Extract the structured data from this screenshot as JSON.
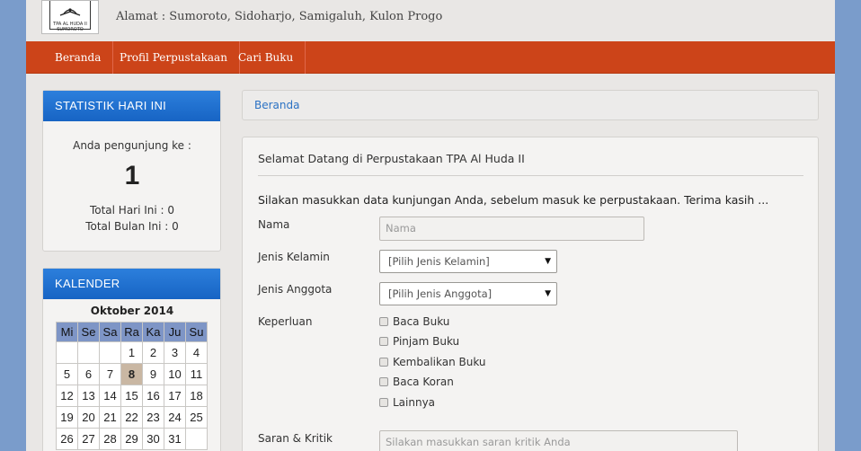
{
  "header": {
    "logo_text": "TPA AL HUDA II SUMOROTO",
    "address": "Alamat : Sumoroto, Sidoharjo, Samigaluh, Kulon Progo"
  },
  "nav": {
    "items": [
      "Beranda",
      "Profil Perpustakaan",
      "Cari Buku"
    ]
  },
  "colors": {
    "navbar": "#cc4419",
    "panel_header": "#1e6fd0",
    "background": "#7a9ccb",
    "link": "#2b72c4"
  },
  "stats": {
    "title": "STATISTIK HARI INI",
    "visitor_label": "Anda pengunjung ke :",
    "visitor_number": "1",
    "today_total": "Total Hari Ini : 0",
    "month_total": "Total Bulan Ini : 0"
  },
  "calendar": {
    "title": "KALENDER",
    "month": "Oktober 2014",
    "days": [
      "Mi",
      "Se",
      "Sa",
      "Ra",
      "Ka",
      "Ju",
      "Su"
    ],
    "weeks": [
      [
        "",
        "",
        "",
        "1",
        "2",
        "3",
        "4"
      ],
      [
        "5",
        "6",
        "7",
        "8",
        "9",
        "10",
        "11"
      ],
      [
        "12",
        "13",
        "14",
        "15",
        "16",
        "17",
        "18"
      ],
      [
        "19",
        "20",
        "21",
        "22",
        "23",
        "24",
        "25"
      ],
      [
        "26",
        "27",
        "28",
        "29",
        "30",
        "31",
        ""
      ]
    ],
    "today": "8"
  },
  "breadcrumb": {
    "current": "Beranda"
  },
  "form": {
    "title": "Selamat Datang di Perpustakaan TPA Al Huda II",
    "intro": "Silakan masukkan data kunjungan Anda, sebelum masuk ke perpustakaan. Terima kasih ...",
    "name_label": "Nama",
    "name_placeholder": "Nama",
    "gender_label": "Jenis Kelamin",
    "gender_selected": "[Pilih Jenis Kelamin]",
    "member_label": "Jenis Anggota",
    "member_selected": "[Pilih Jenis Anggota]",
    "purpose_label": "Keperluan",
    "purposes": [
      "Baca Buku",
      "Pinjam Buku",
      "Kembalikan Buku",
      "Baca Koran",
      "Lainnya"
    ],
    "feedback_label": "Saran & Kritik",
    "feedback_placeholder": "Silakan masukkan saran kritik Anda"
  }
}
